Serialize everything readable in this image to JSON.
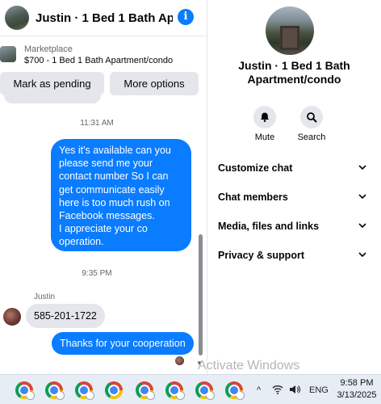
{
  "header": {
    "title": "Justin · 1 Bed 1 Bath Apart...",
    "info_glyph": "i"
  },
  "marketplace": {
    "label": "Marketplace",
    "listing": "$700 - 1 Bed 1 Bath Apartment/condo",
    "mark_pending_label": "Mark as pending",
    "more_options_label": "More options"
  },
  "messages": {
    "time_1": "11:31 AM",
    "outgoing_1": "Yes it's available can you please send me your contact number So I can get communicate easily here is too much rush on Facebook messages.\nI appreciate your co operation.",
    "time_2": "9:35 PM",
    "sender_name": "Justin",
    "incoming_1": "585-201-1722",
    "outgoing_2": "Thanks for your cooperation"
  },
  "details": {
    "title": "Justin · 1 Bed 1 Bath Apartment/condo",
    "mute_label": "Mute",
    "search_label": "Search",
    "sections": [
      {
        "label": "Customize chat"
      },
      {
        "label": "Chat members"
      },
      {
        "label": "Media, files and links"
      },
      {
        "label": "Privacy & support"
      }
    ]
  },
  "watermark": "Activate Windows",
  "taskbar": {
    "tray_arrow": "^",
    "language": "ENG",
    "time": "9:58 PM",
    "date": "3/13/2025"
  },
  "colors": {
    "messenger_blue": "#0a7cff",
    "bubble_gray": "#e4e6eb",
    "secondary_text": "#65676b"
  }
}
